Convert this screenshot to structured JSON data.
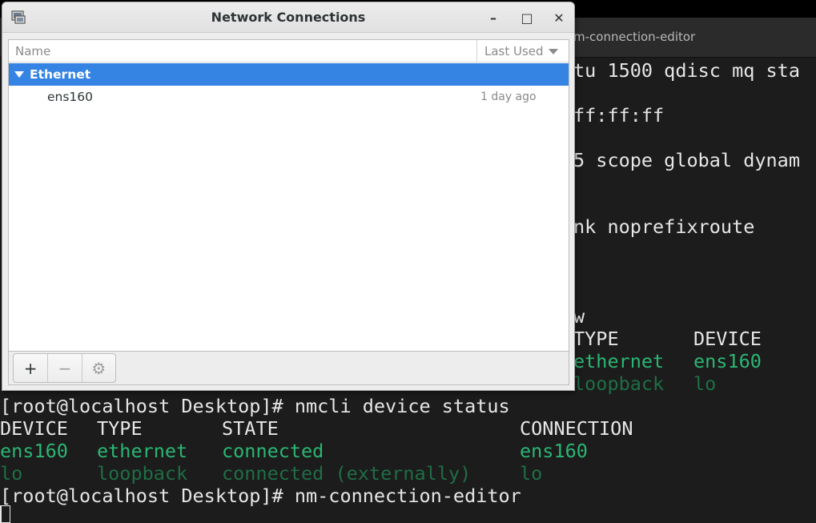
{
  "terminal": {
    "title": "m-connection-editor",
    "right_lines": [
      "tu 1500 qdisc mq sta",
      "ff:ff:ff",
      "5 scope global dynam",
      "nk noprefixroute",
      "w"
    ],
    "right_table_header": {
      "type": "TYPE",
      "device": "DEVICE"
    },
    "right_rows": [
      {
        "type": "ethernet",
        "device": "ens160"
      },
      {
        "type": "loopback",
        "device": "lo"
      }
    ],
    "cmd1": "[root@localhost Desktop]# nmcli device status",
    "table_header": {
      "device": "DEVICE",
      "type": "TYPE",
      "state": "STATE",
      "connection": "CONNECTION"
    },
    "rows": [
      {
        "device": "ens160",
        "type": "ethernet",
        "state": "connected",
        "connection": "ens160"
      },
      {
        "device": "lo",
        "type": "loopback",
        "state": "connected (externally)",
        "connection": "lo"
      }
    ],
    "cmd2": "[root@localhost Desktop]# nm-connection-editor",
    "colors": {
      "green": "#2bb673",
      "dim_green": "#1f6e45",
      "text": "#e6e6e6",
      "background": "#1c1c1c"
    }
  },
  "dialog": {
    "title": "Network Connections",
    "window_buttons": {
      "minimize": "–",
      "maximize": "□",
      "close": "✕"
    },
    "columns": {
      "name": "Name",
      "last_used": "Last Used"
    },
    "groups": [
      {
        "label": "Ethernet",
        "items": [
          {
            "name": "ens160",
            "last_used": "1 day ago"
          }
        ]
      }
    ],
    "toolbar": {
      "add": "+",
      "remove": "−",
      "settings": "⚙"
    },
    "colors": {
      "selection": "#3584e4"
    }
  }
}
